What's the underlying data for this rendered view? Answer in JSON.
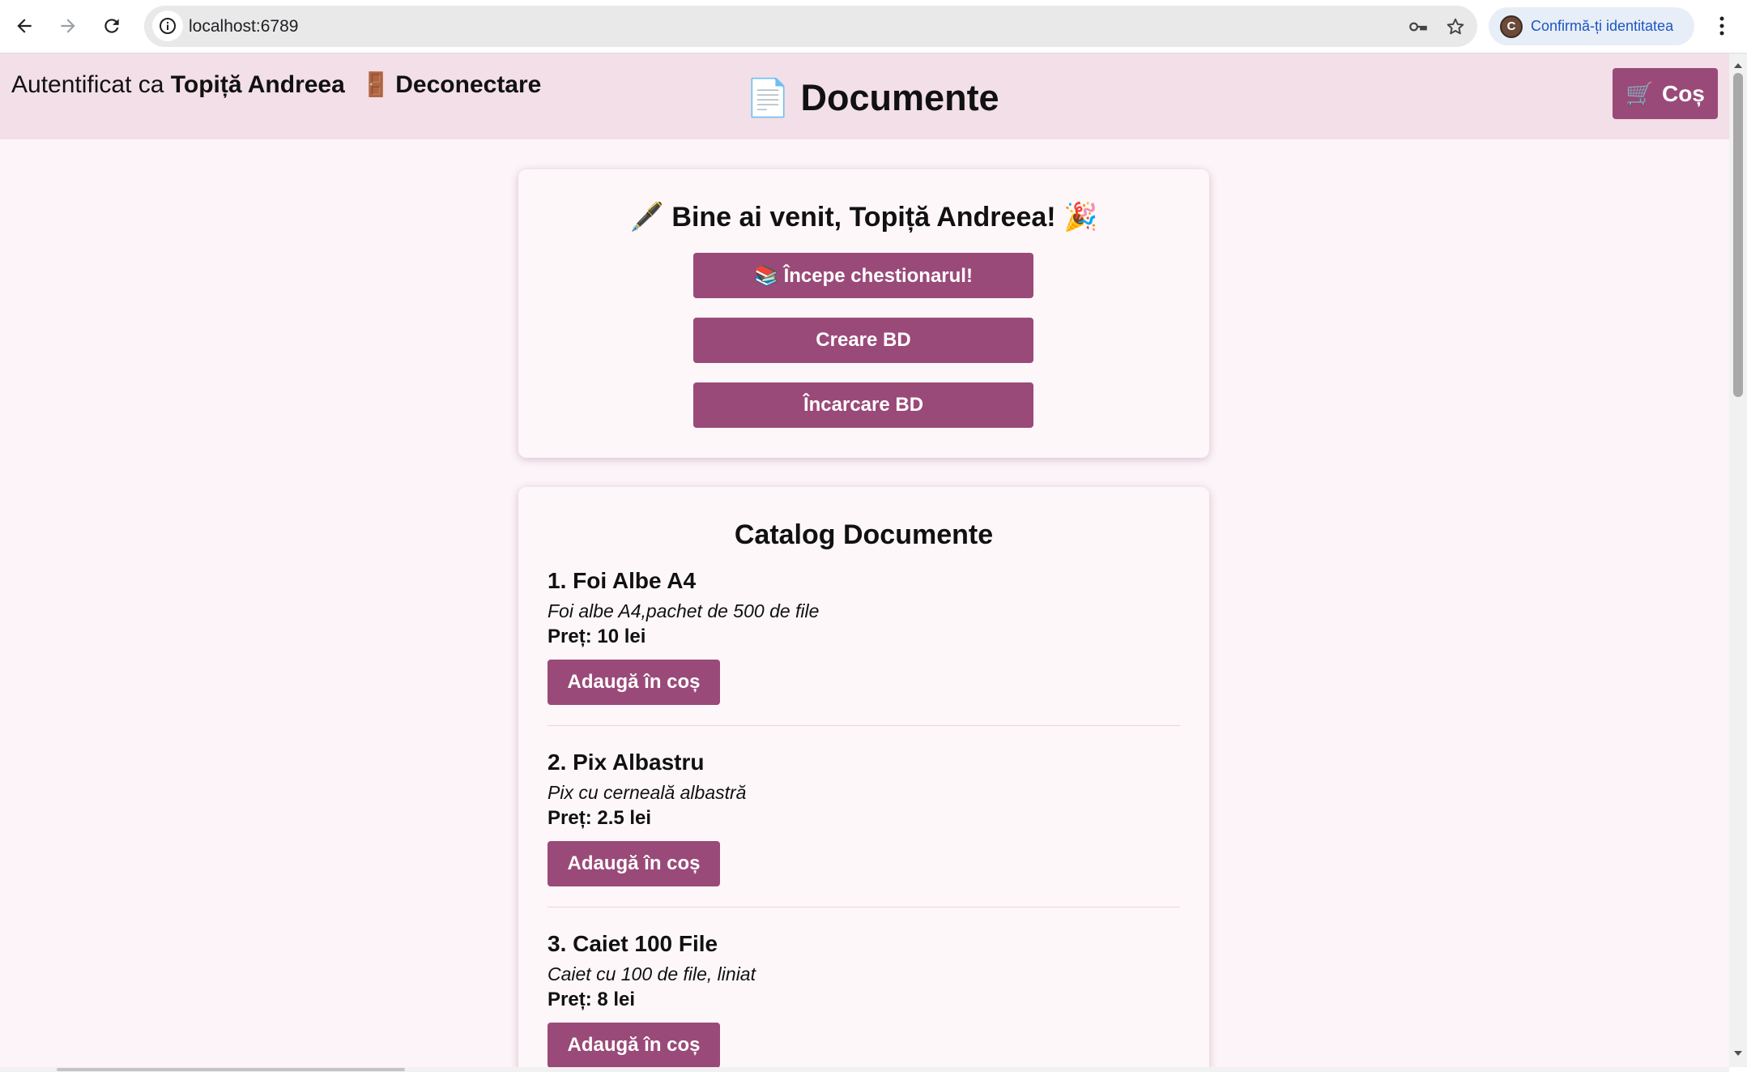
{
  "browser": {
    "url": "localhost:6789",
    "profile_label": "Confirmă-ți identitatea",
    "profile_initial": "C"
  },
  "header": {
    "auth_prefix": "Autentificat ca",
    "user_name": "Topiță Andreea",
    "logout_icon": "🚪",
    "logout_label": "Deconectare",
    "title_icon": "📄",
    "title": "Documente",
    "cart_icon": "🛒",
    "cart_label": "Coș"
  },
  "welcome": {
    "title": "🖋️ Bine ai venit, Topiță Andreea! 🎉",
    "buttons": [
      "📚 Începe chestionarul!",
      "Creare BD",
      "Încarcare BD"
    ]
  },
  "catalog": {
    "title": "Catalog Documente",
    "add_label": "Adaugă în coș",
    "products": [
      {
        "name": "1. Foi Albe A4",
        "description": "Foi albe A4,pachet de 500 de file",
        "price": "Preț: 10 lei"
      },
      {
        "name": "2. Pix Albastru",
        "description": "Pix cu cerneală albastră",
        "price": "Preț: 2.5 lei"
      },
      {
        "name": "3. Caiet 100 File",
        "description": "Caiet cu 100 de file, liniat",
        "price": "Preț: 8 lei"
      }
    ]
  },
  "colors": {
    "accent": "#9a4a78",
    "header_bg": "#f2dfe7",
    "page_bg": "#fcf4f8"
  }
}
